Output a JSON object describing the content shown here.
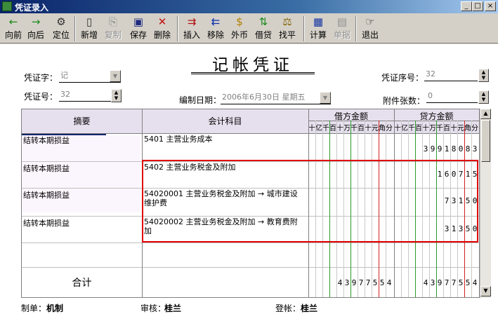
{
  "window": {
    "title": "凭证录入",
    "min": "_",
    "max": "□",
    "close": "×"
  },
  "toolbar": [
    {
      "label": "向前",
      "icon": "←",
      "color": "#1a8a1a",
      "disabled": false
    },
    {
      "label": "向后",
      "icon": "→",
      "color": "#1a8a1a",
      "disabled": false
    },
    {
      "label": "定位",
      "icon": "⚙",
      "color": "#303030",
      "disabled": false
    },
    {
      "label": "新增",
      "icon": "▯",
      "color": "#303030",
      "disabled": false
    },
    {
      "label": "复制",
      "icon": "⎘",
      "color": "#909090",
      "disabled": true
    },
    {
      "label": "保存",
      "icon": "▣",
      "color": "#202a80",
      "disabled": false
    },
    {
      "label": "删除",
      "icon": "✕",
      "color": "#c01010",
      "disabled": false
    },
    {
      "label": "插入",
      "icon": "⇉",
      "color": "#b01010",
      "disabled": false
    },
    {
      "label": "移除",
      "icon": "⇇",
      "color": "#1030b0",
      "disabled": false
    },
    {
      "label": "外币",
      "icon": "$",
      "color": "#b08000",
      "disabled": false
    },
    {
      "label": "借贷",
      "icon": "⇅",
      "color": "#1a8a1a",
      "disabled": false
    },
    {
      "label": "找平",
      "icon": "⚖",
      "color": "#806000",
      "disabled": false
    },
    {
      "label": "计算",
      "icon": "▦",
      "color": "#1030a0",
      "disabled": false
    },
    {
      "label": "单据",
      "icon": "▤",
      "color": "#909090",
      "disabled": true
    },
    {
      "label": "退出",
      "icon": "☞",
      "color": "#303030",
      "disabled": false
    }
  ],
  "header": {
    "title": "记帐凭证",
    "voucher_type_label": "凭证字：",
    "voucher_type_value": "记",
    "voucher_no_label": "凭证号：",
    "voucher_no_value": "32",
    "date_label": "编制日期：",
    "date_value": "2006年6月30日 星期五",
    "seq_label": "凭证序号：",
    "seq_value": "32",
    "attach_label": "附件张数：",
    "attach_value": "0"
  },
  "grid": {
    "col_summary": "摘要",
    "col_account": "会计科目",
    "col_debit": "借方金额",
    "col_credit": "贷方金额",
    "units": [
      "十",
      "亿",
      "千",
      "百",
      "十",
      "万",
      "千",
      "百",
      "十",
      "元",
      "角",
      "分"
    ],
    "rows": [
      {
        "summary": "结转本期损益",
        "account": "5401 主营业务成本",
        "debit": "",
        "credit": "3991808 3"
      },
      {
        "summary": "结转本期损益",
        "account": "5402 主营业务税金及附加",
        "debit": "",
        "credit": "160715"
      },
      {
        "summary": "结转本期损益",
        "account": "54020001 主营业务税金及附加 → 城市建设维护费",
        "debit": "",
        "credit": "73150"
      },
      {
        "summary": "结转本期损益",
        "account": "54020002 主营业务税金及附加 → 教育费附加",
        "debit": "",
        "credit": "31350"
      },
      {
        "summary": "",
        "account": "",
        "debit": "",
        "credit": ""
      }
    ],
    "total_label": "合计",
    "total_debit": "43977554",
    "total_credit": "43977554"
  },
  "footer": {
    "maker_label": "制单：",
    "maker": "机制",
    "auditor_label": "审核：",
    "auditor": "桂兰",
    "poster_label": "登帐：",
    "poster": "桂兰"
  },
  "colors": {
    "selection": "#0a246a",
    "highlight_border": "#e00000",
    "digit_line_green": "#2a9a2a",
    "digit_line_red": "#d02020"
  }
}
